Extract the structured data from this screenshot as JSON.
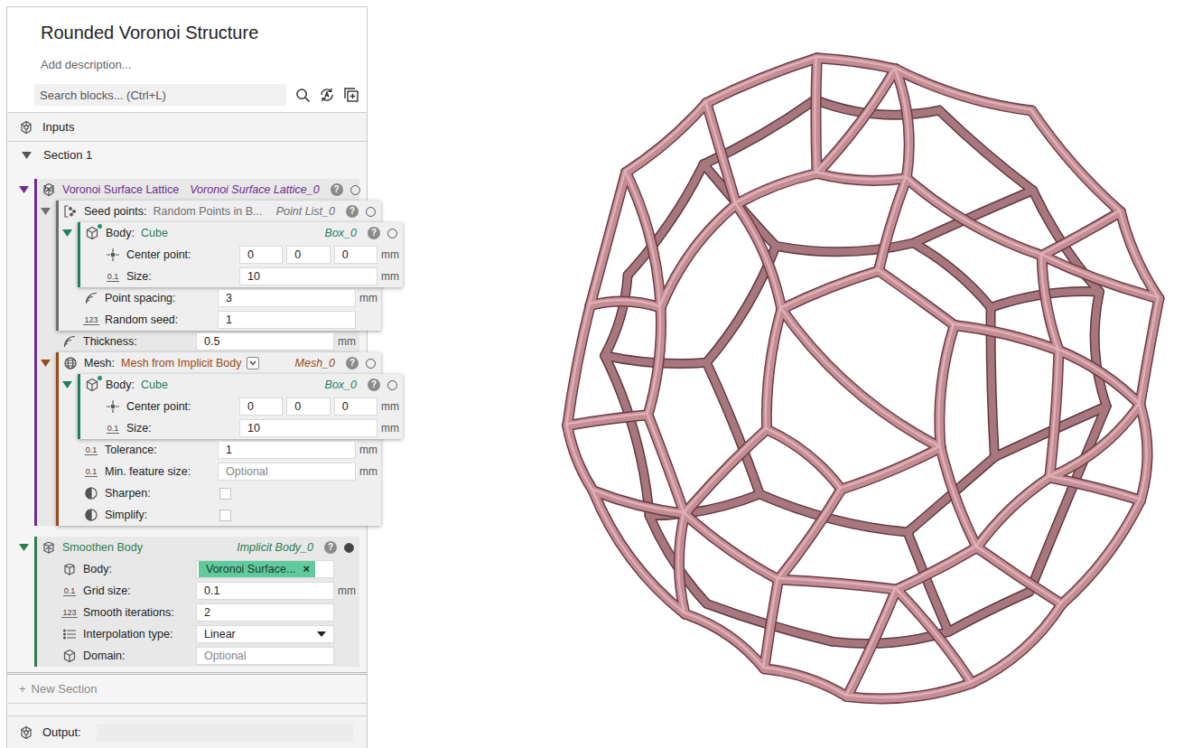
{
  "app": {
    "title": "Rounded Voronoi Structure",
    "description": "Add description...",
    "search": {
      "placeholder": "Search blocks... (Ctrl+L)"
    },
    "inputs": {
      "label": "Inputs"
    },
    "sections": [
      {
        "label": "Section 1",
        "expanded": true,
        "blocks": [
          {
            "kind": "lattice-block",
            "type_name": "Voronoi Surface Lattice",
            "instance": "Voronoi Surface Lattice_0",
            "help": "?",
            "color": "#6b2d8f",
            "expanded": true,
            "active": false,
            "children": [
              {
                "kind": "points-block",
                "label": "Seed points:",
                "type_name": "Random Points in B...",
                "instance": "Point List_0",
                "help": "?",
                "color": "#6f6f6f",
                "expanded": true,
                "active": false,
                "children": [
                  {
                    "kind": "body-block",
                    "label": "Body:",
                    "type_name": "Cube",
                    "instance": "Box_0",
                    "help": "?",
                    "color": "#1f8060",
                    "expanded": true,
                    "active": false,
                    "linked": true,
                    "children": [
                      {
                        "kind": "vector",
                        "label": "Center point:",
                        "values": [
                          "0",
                          "0",
                          "0"
                        ],
                        "unit": "mm"
                      },
                      {
                        "kind": "scalar",
                        "icon_text": "0.1",
                        "label": "Size:",
                        "value": "10",
                        "unit": "mm"
                      }
                    ]
                  },
                  {
                    "kind": "distance",
                    "label": "Point spacing:",
                    "value": "3",
                    "unit": "mm"
                  },
                  {
                    "kind": "integer",
                    "icon_text": "123",
                    "label": "Random seed:",
                    "value": "1"
                  }
                ]
              },
              {
                "kind": "distance",
                "label": "Thickness:",
                "value": "0.5",
                "unit": "mm"
              },
              {
                "kind": "mesh-block",
                "label": "Mesh:",
                "type_name": "Mesh from Implicit Body",
                "instance": "Mesh_0",
                "help": "?",
                "color": "#9b4a14",
                "expanded": true,
                "active": false,
                "children": [
                  {
                    "kind": "body-block",
                    "label": "Body:",
                    "type_name": "Cube",
                    "instance": "Box_0",
                    "help": "?",
                    "color": "#1f8060",
                    "expanded": true,
                    "active": false,
                    "linked": true,
                    "children": [
                      {
                        "kind": "vector",
                        "label": "Center point:",
                        "values": [
                          "0",
                          "0",
                          "0"
                        ],
                        "unit": "mm"
                      },
                      {
                        "kind": "scalar",
                        "icon_text": "0.1",
                        "label": "Size:",
                        "value": "10",
                        "unit": "mm"
                      }
                    ]
                  },
                  {
                    "kind": "scalar",
                    "icon_text": "0.1",
                    "label": "Tolerance:",
                    "value": "1",
                    "unit": "mm"
                  },
                  {
                    "kind": "scalar",
                    "icon_text": "0.1",
                    "label": "Min. feature size:",
                    "placeholder": "Optional",
                    "unit": "mm"
                  },
                  {
                    "kind": "bool",
                    "label": "Sharpen:",
                    "checked": false
                  },
                  {
                    "kind": "bool",
                    "label": "Simplify:",
                    "checked": false
                  }
                ]
              }
            ]
          },
          {
            "kind": "smooth-block",
            "type_name": "Smoothen Body",
            "instance": "Implicit Body_0",
            "help": "?",
            "color": "#2e7d4e",
            "expanded": true,
            "active": true,
            "children": [
              {
                "kind": "body-ref",
                "label": "Body:",
                "tag": "Voronoi Surface...",
                "remove": "×"
              },
              {
                "kind": "scalar",
                "icon_text": "0.1",
                "label": "Grid size:",
                "value": "0.1",
                "unit": "mm"
              },
              {
                "kind": "integer",
                "icon_text": "123",
                "label": "Smooth iterations:",
                "value": "2"
              },
              {
                "kind": "enum",
                "label": "Interpolation type:",
                "value": "Linear"
              },
              {
                "kind": "domain",
                "label": "Domain:",
                "placeholder": "Optional"
              }
            ]
          }
        ]
      }
    ],
    "new_section": {
      "icon": "+",
      "label": "New Section"
    },
    "output": {
      "label": "Output:",
      "value": ""
    }
  }
}
